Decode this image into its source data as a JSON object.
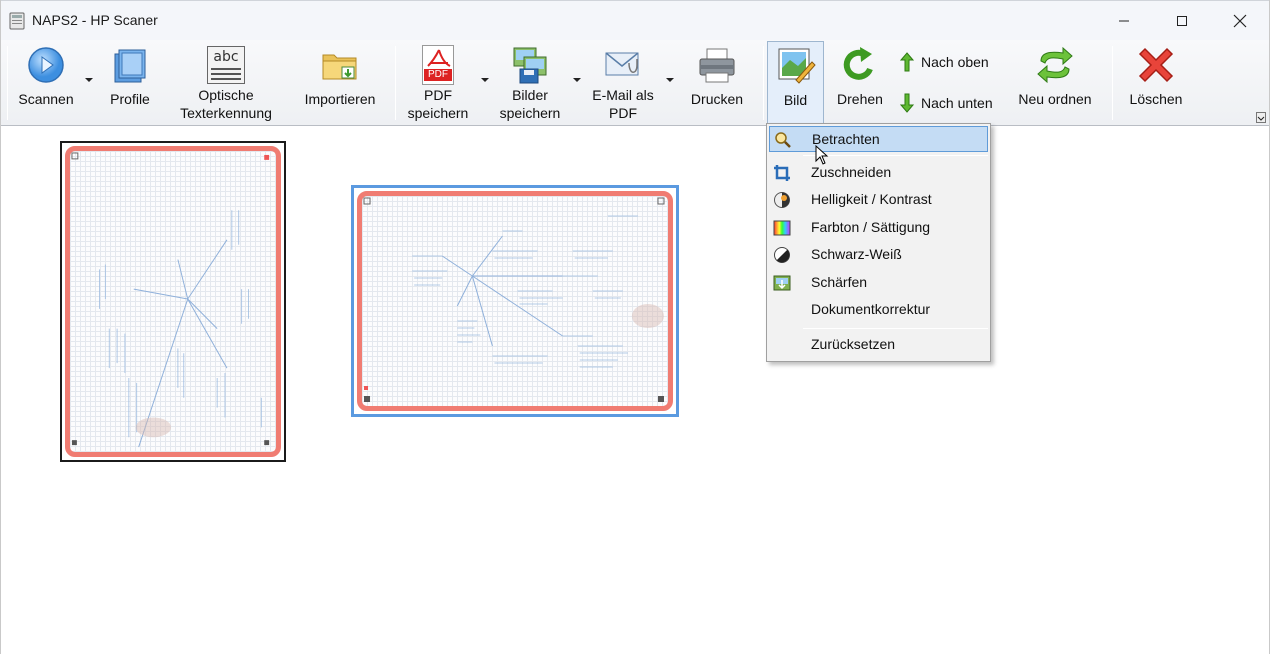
{
  "window": {
    "title": "NAPS2 - HP Scaner",
    "controls": [
      "minimize-icon",
      "maximize-icon",
      "close-icon"
    ]
  },
  "toolbar": {
    "scan": {
      "label": "Scannen",
      "icon": "scan-play-icon"
    },
    "profiles": {
      "label": "Profile",
      "icon": "profiles-icon"
    },
    "ocr": {
      "label_line1": "Optische",
      "label_line2": "Texterkennung",
      "icon_text": "abc",
      "icon": "ocr-icon"
    },
    "import": {
      "label": "Importieren",
      "icon": "folder-import-icon"
    },
    "save_pdf": {
      "label_line1": "PDF",
      "label_line2": "speichern",
      "icon_text": "PDF",
      "icon": "pdf-icon"
    },
    "save_images": {
      "label_line1": "Bilder",
      "label_line2": "speichern",
      "icon": "save-images-icon"
    },
    "email_pdf": {
      "label_line1": "E-Mail als",
      "label_line2": "PDF",
      "icon": "email-icon"
    },
    "print": {
      "label": "Drucken",
      "icon": "printer-icon"
    },
    "image": {
      "label": "Bild",
      "icon": "image-edit-icon",
      "pressed": true
    },
    "rotate": {
      "label": "Drehen",
      "icon": "rotate-icon"
    },
    "move_up": {
      "label": "Nach oben",
      "icon": "arrow-up-icon"
    },
    "move_down": {
      "label": "Nach unten",
      "icon": "arrow-down-icon"
    },
    "reorder": {
      "label": "Neu ordnen",
      "icon": "reorder-icon"
    },
    "delete": {
      "label": "Löschen",
      "icon": "delete-x-icon"
    }
  },
  "image_menu": {
    "items": [
      {
        "label": "Betrachten",
        "icon": "magnifier-icon",
        "highlighted": true
      },
      {
        "label": "Zuschneiden",
        "icon": "crop-icon"
      },
      {
        "label": "Helligkeit / Kontrast",
        "icon": "brightness-contrast-icon"
      },
      {
        "label": "Farbton / Sättigung",
        "icon": "hue-saturation-icon"
      },
      {
        "label": "Schwarz-Weiß",
        "icon": "black-white-icon"
      },
      {
        "label": "Schärfen",
        "icon": "sharpen-icon"
      },
      {
        "label": "Dokumentkorrektur",
        "icon": ""
      },
      {
        "label": "Zurücksetzen",
        "icon": ""
      }
    ]
  },
  "pages": [
    {
      "orientation": "portrait",
      "selected": false,
      "content": "mind-map-scan"
    },
    {
      "orientation": "landscape",
      "selected": true,
      "content": "mind-map-scan"
    }
  ],
  "colors": {
    "accent_selection": "#5b9ae0",
    "menu_highlight": "#c4dcf4",
    "paper_border": "#f07c72",
    "ink": "#7fa6d6"
  }
}
